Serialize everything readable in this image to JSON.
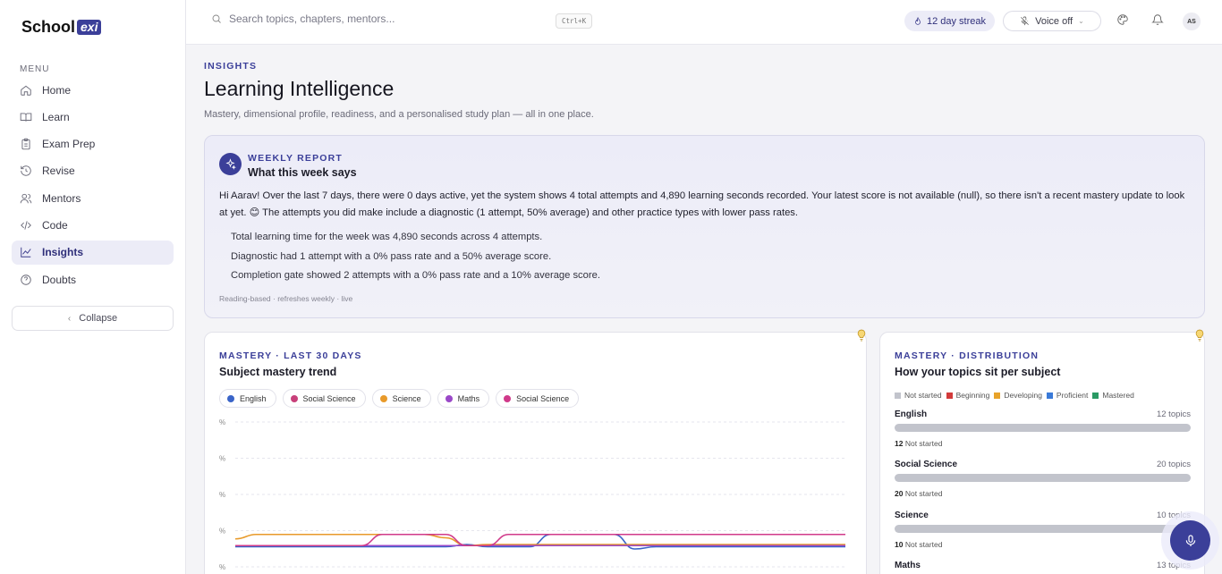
{
  "brand": {
    "name": "School",
    "tag": "exi"
  },
  "sidebar": {
    "menu_label": "MENU",
    "items": [
      {
        "label": "Home",
        "icon": "home-icon"
      },
      {
        "label": "Learn",
        "icon": "book-icon"
      },
      {
        "label": "Exam Prep",
        "icon": "clipboard-icon"
      },
      {
        "label": "Revise",
        "icon": "rotate-icon"
      },
      {
        "label": "Mentors",
        "icon": "users-icon"
      },
      {
        "label": "Code",
        "icon": "code-icon"
      },
      {
        "label": "Insights",
        "icon": "chart-line-icon",
        "active": true
      },
      {
        "label": "Doubts",
        "icon": "help-circle-icon"
      }
    ],
    "collapse_label": "Collapse"
  },
  "topbar": {
    "search_placeholder": "Search topics, chapters, mentors...",
    "shortcut": "Ctrl+K",
    "streak": "12 day streak",
    "voice": "Voice off",
    "avatar": "AS"
  },
  "page": {
    "eyebrow": "INSIGHTS",
    "title": "Learning Intelligence",
    "subtitle": "Mastery, dimensional profile, readiness, and a personalised study plan — all in one place."
  },
  "report": {
    "eyebrow": "WEEKLY REPORT",
    "title": "What this week says",
    "body": "Hi Aarav! Over the last 7 days, there were 0 days active, yet the system shows 4 total attempts and 4,890 learning seconds recorded. Your latest score is not available (null), so there isn't a recent mastery update to look at yet. 😊 The attempts you did make include a diagnostic (1 attempt, 50% average) and other practice types with lower pass rates.",
    "points": [
      "Total learning time for the week was 4,890 seconds across 4 attempts.",
      "Diagnostic had 1 attempt with a 0% pass rate and a 50% average score.",
      "Completion gate showed 2 attempts with a 0% pass rate and a 10% average score."
    ],
    "footer": "Reading-based · refreshes weekly · live"
  },
  "trend": {
    "eyebrow": "MASTERY · LAST 30 DAYS",
    "title": "Subject mastery trend",
    "legend": [
      {
        "name": "English",
        "color": "#3a64c8"
      },
      {
        "name": "Social Science",
        "color": "#c8407a"
      },
      {
        "name": "Science",
        "color": "#e89a2a"
      },
      {
        "name": "Maths",
        "color": "#9a48c8"
      },
      {
        "name": "Social Science",
        "color": "#d03a8a"
      }
    ],
    "y_tick_labels": [
      "%",
      "%",
      "%",
      "%",
      "%"
    ]
  },
  "chart_data": {
    "type": "line",
    "title": "Subject mastery trend",
    "x": [
      0,
      1,
      2,
      3,
      4,
      5,
      6,
      7,
      8,
      9,
      10,
      11,
      12,
      13,
      14,
      15,
      16,
      17,
      18,
      19,
      20,
      21,
      22,
      23,
      24,
      25,
      26,
      27,
      28,
      29
    ],
    "series": [
      {
        "name": "English",
        "color": "#3a64c8",
        "values": [
          2,
          2,
          2,
          2,
          2,
          2,
          2,
          2,
          2,
          2,
          2,
          4,
          2,
          2,
          2,
          13,
          13,
          13,
          13,
          0,
          2,
          2,
          2,
          2,
          2,
          2,
          2,
          2,
          2,
          2
        ]
      },
      {
        "name": "Social Science",
        "color": "#c8407a",
        "values": [
          3,
          3,
          3,
          3,
          3,
          3,
          3,
          3,
          3,
          3,
          3,
          3,
          3,
          3,
          3,
          3,
          3,
          3,
          3,
          3,
          3,
          3,
          3,
          3,
          3,
          3,
          3,
          3,
          3,
          3
        ]
      },
      {
        "name": "Science",
        "color": "#e89a2a",
        "values": [
          9,
          13,
          13,
          13,
          13,
          13,
          13,
          13,
          13,
          13,
          10,
          3,
          4,
          4,
          4,
          4,
          4,
          4,
          4,
          4,
          4,
          4,
          4,
          4,
          4,
          4,
          4,
          4,
          4,
          4
        ]
      },
      {
        "name": "Maths",
        "color": "#9a48c8",
        "values": [
          3,
          3,
          3,
          3,
          3,
          3,
          3,
          3,
          3,
          3,
          3,
          3,
          3,
          3,
          3,
          3,
          3,
          3,
          3,
          3,
          3,
          3,
          3,
          3,
          3,
          3,
          3,
          3,
          3,
          3
        ]
      },
      {
        "name": "Social Science",
        "color": "#d03a8a",
        "values": [
          3,
          3,
          3,
          3,
          3,
          3,
          3,
          13,
          13,
          13,
          13,
          3,
          3,
          13,
          13,
          13,
          13,
          13,
          13,
          13,
          13,
          13,
          13,
          13,
          13,
          13,
          13,
          13,
          13,
          13
        ]
      }
    ],
    "ylim": [
      0,
      100
    ],
    "grid": true
  },
  "distribution": {
    "eyebrow": "MASTERY · DISTRIBUTION",
    "title": "How your topics sit per subject",
    "legend": [
      {
        "name": "Not started",
        "color": "#c2c4cc"
      },
      {
        "name": "Beginning",
        "color": "#d23a3a"
      },
      {
        "name": "Developing",
        "color": "#e8a32a"
      },
      {
        "name": "Proficient",
        "color": "#3a7ad8"
      },
      {
        "name": "Mastered",
        "color": "#2a9a64"
      }
    ],
    "subjects": [
      {
        "name": "English",
        "count": "12 topics",
        "not_started": "12",
        "label": "Not started"
      },
      {
        "name": "Social Science",
        "count": "20 topics",
        "not_started": "20",
        "label": "Not started"
      },
      {
        "name": "Science",
        "count": "10 topics",
        "not_started": "10",
        "label": "Not started"
      },
      {
        "name": "Maths",
        "count": "13 topics"
      }
    ]
  }
}
